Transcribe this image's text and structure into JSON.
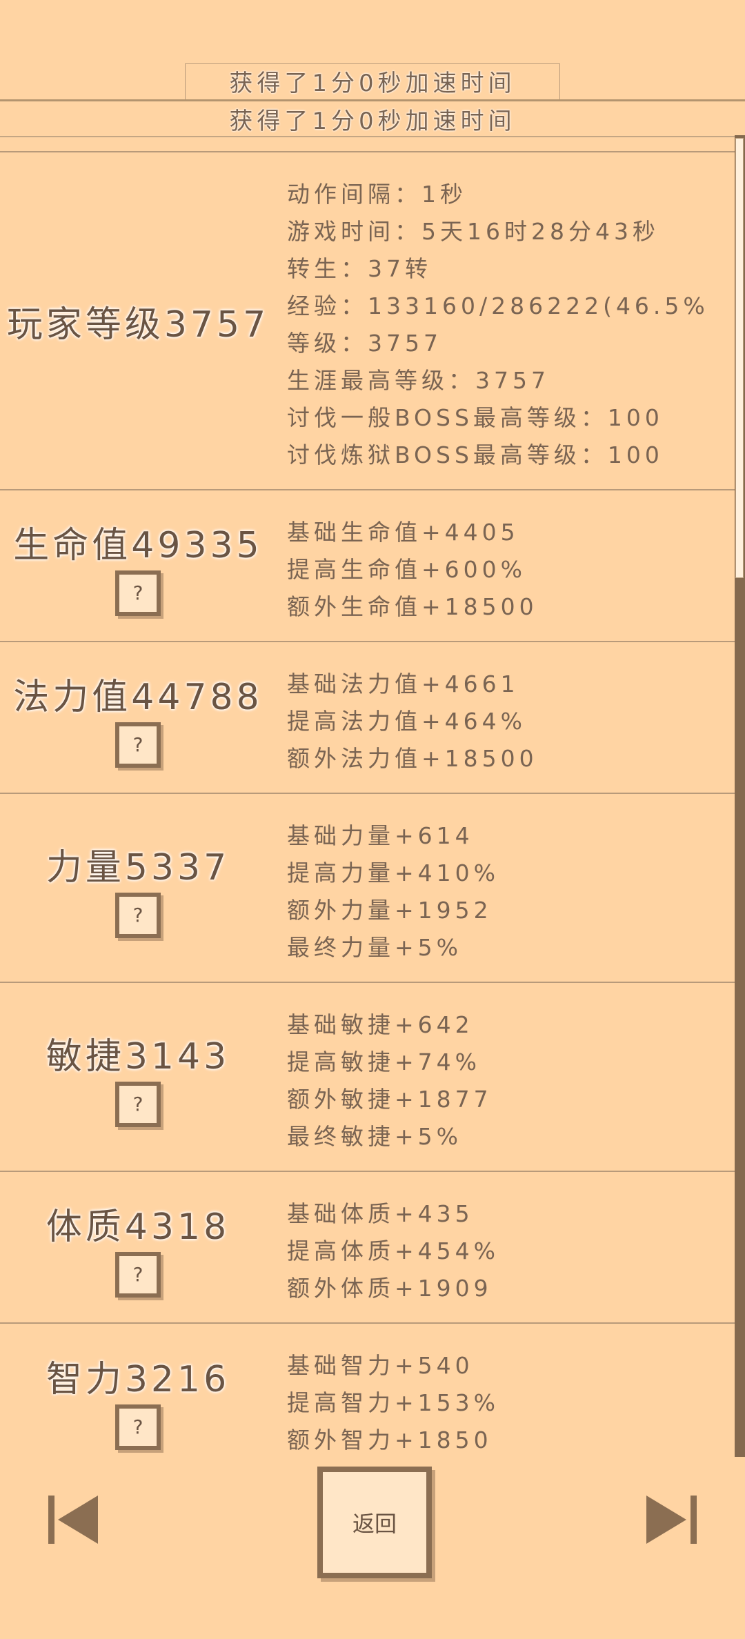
{
  "toasts": [
    "获得了1分0秒加速时间",
    "获得了1分0秒加速时间"
  ],
  "stats": [
    {
      "title": "玩家等级3757",
      "has_help": false,
      "lines": [
        "动作间隔：1秒",
        "游戏时间：5天16时28分43秒",
        "转生：37转",
        "经验：133160/286222(46.5%",
        "等级：3757",
        "生涯最高等级：3757",
        "讨伐一般BOSS最高等级：100",
        "讨伐炼狱BOSS最高等级：100"
      ]
    },
    {
      "title": "生命值49335",
      "has_help": true,
      "lines": [
        "基础生命值+4405",
        "提高生命值+600%",
        "额外生命值+18500"
      ]
    },
    {
      "title": "法力值44788",
      "has_help": true,
      "lines": [
        "基础法力值+4661",
        "提高法力值+464%",
        "额外法力值+18500"
      ]
    },
    {
      "title": "力量5337",
      "has_help": true,
      "lines": [
        "基础力量+614",
        "提高力量+410%",
        "额外力量+1952",
        "最终力量+5%"
      ]
    },
    {
      "title": "敏捷3143",
      "has_help": true,
      "lines": [
        "基础敏捷+642",
        "提高敏捷+74%",
        "额外敏捷+1877",
        "最终敏捷+5%"
      ]
    },
    {
      "title": "体质4318",
      "has_help": true,
      "lines": [
        "基础体质+435",
        "提高体质+454%",
        "额外体质+1909"
      ]
    },
    {
      "title": "智力3216",
      "has_help": true,
      "lines": [
        "基础智力+540",
        "提高智力+153%",
        "额外智力+1850"
      ]
    }
  ],
  "help_label": "?",
  "nav": {
    "back_label": "返回",
    "prev_icon": "skip-previous-icon",
    "next_icon": "skip-next-icon"
  },
  "colors": {
    "background": "#FFD4A3",
    "border": "#8b6e52",
    "text": "#7a6452",
    "button_fill": "#FFE6C7"
  }
}
